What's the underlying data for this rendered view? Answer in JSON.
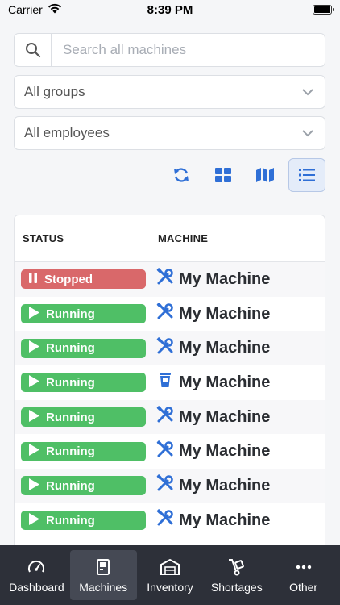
{
  "status_bar": {
    "carrier": "Carrier",
    "time": "8:39 PM"
  },
  "search": {
    "placeholder": "Search all machines",
    "value": ""
  },
  "filters": {
    "groups": "All groups",
    "employees": "All employees"
  },
  "table": {
    "headers": {
      "status": "STATUS",
      "machine": "MACHINE"
    },
    "rows": [
      {
        "status": "Stopped",
        "state": "stopped",
        "icon": "tools-icon",
        "machine": "My Machine"
      },
      {
        "status": "Running",
        "state": "running",
        "icon": "tools-icon",
        "machine": "My Machine"
      },
      {
        "status": "Running",
        "state": "running",
        "icon": "tools-icon",
        "machine": "My Machine"
      },
      {
        "status": "Running",
        "state": "running",
        "icon": "cup-icon",
        "machine": "My Machine"
      },
      {
        "status": "Running",
        "state": "running",
        "icon": "tools-icon",
        "machine": "My Machine"
      },
      {
        "status": "Running",
        "state": "running",
        "icon": "tools-icon",
        "machine": "My Machine"
      },
      {
        "status": "Running",
        "state": "running",
        "icon": "tools-icon",
        "machine": "My Machine"
      },
      {
        "status": "Running",
        "state": "running",
        "icon": "tools-icon",
        "machine": "My Machine"
      }
    ]
  },
  "tabbar": {
    "items": [
      {
        "label": "Dashboard",
        "icon": "gauge-icon"
      },
      {
        "label": "Machines",
        "icon": "machine-icon",
        "active": true
      },
      {
        "label": "Inventory",
        "icon": "warehouse-icon"
      },
      {
        "label": "Shortages",
        "icon": "dolly-icon"
      },
      {
        "label": "Other",
        "icon": "ellipsis-icon"
      }
    ]
  },
  "colors": {
    "accent": "#2f6fd6",
    "stopped": "#d9686a",
    "running": "#4fbf66",
    "tabbar": "#2d3039"
  }
}
